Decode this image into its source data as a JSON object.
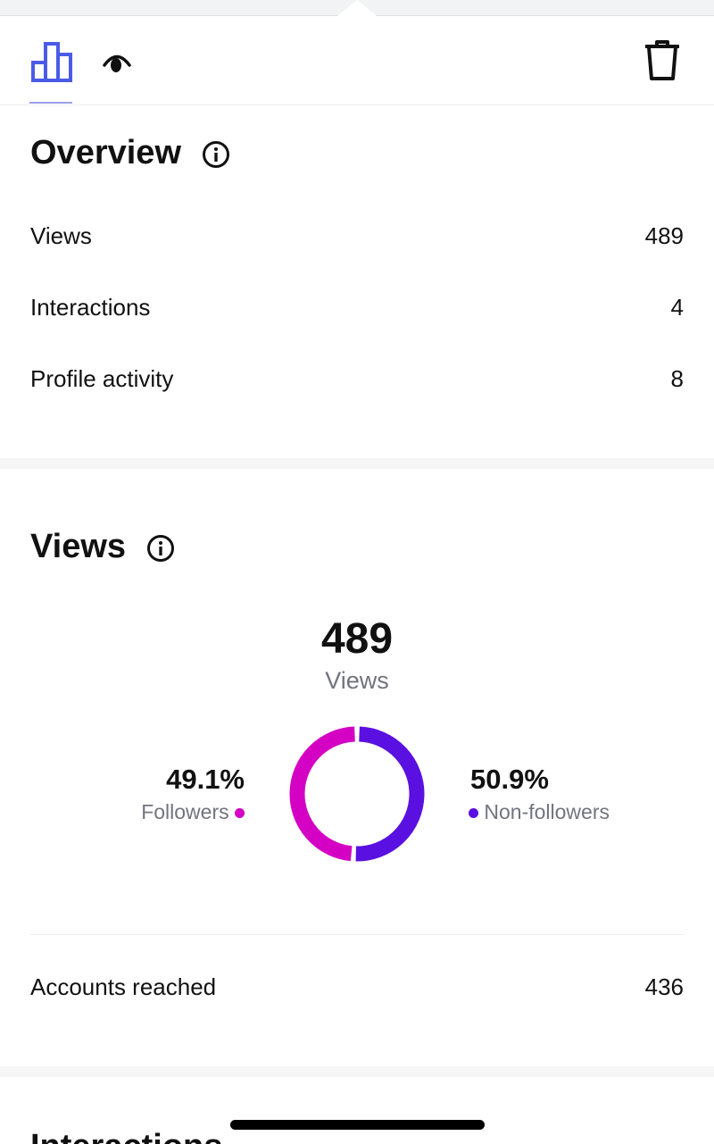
{
  "tabs": [
    {
      "icon": "bar-chart-icon",
      "active": true
    },
    {
      "icon": "eye-icon",
      "active": false
    }
  ],
  "toolbar": {
    "delete_icon": "trash-icon"
  },
  "colors": {
    "accent": "#4a5be8",
    "followers": "#d400c4",
    "non_followers": "#5a10e0"
  },
  "overview": {
    "title": "Overview",
    "rows": [
      {
        "label": "Views",
        "value": "489"
      },
      {
        "label": "Interactions",
        "value": "4"
      },
      {
        "label": "Profile activity",
        "value": "8"
      }
    ]
  },
  "views": {
    "title": "Views",
    "total": "489",
    "total_label": "Views",
    "followers": {
      "pct": "49.1%",
      "label": "Followers",
      "value": 49.1
    },
    "non_followers": {
      "pct": "50.9%",
      "label": "Non-followers",
      "value": 50.9
    },
    "accounts_reached_label": "Accounts reached",
    "accounts_reached": "436"
  },
  "next_section": {
    "title": "Interactions"
  }
}
